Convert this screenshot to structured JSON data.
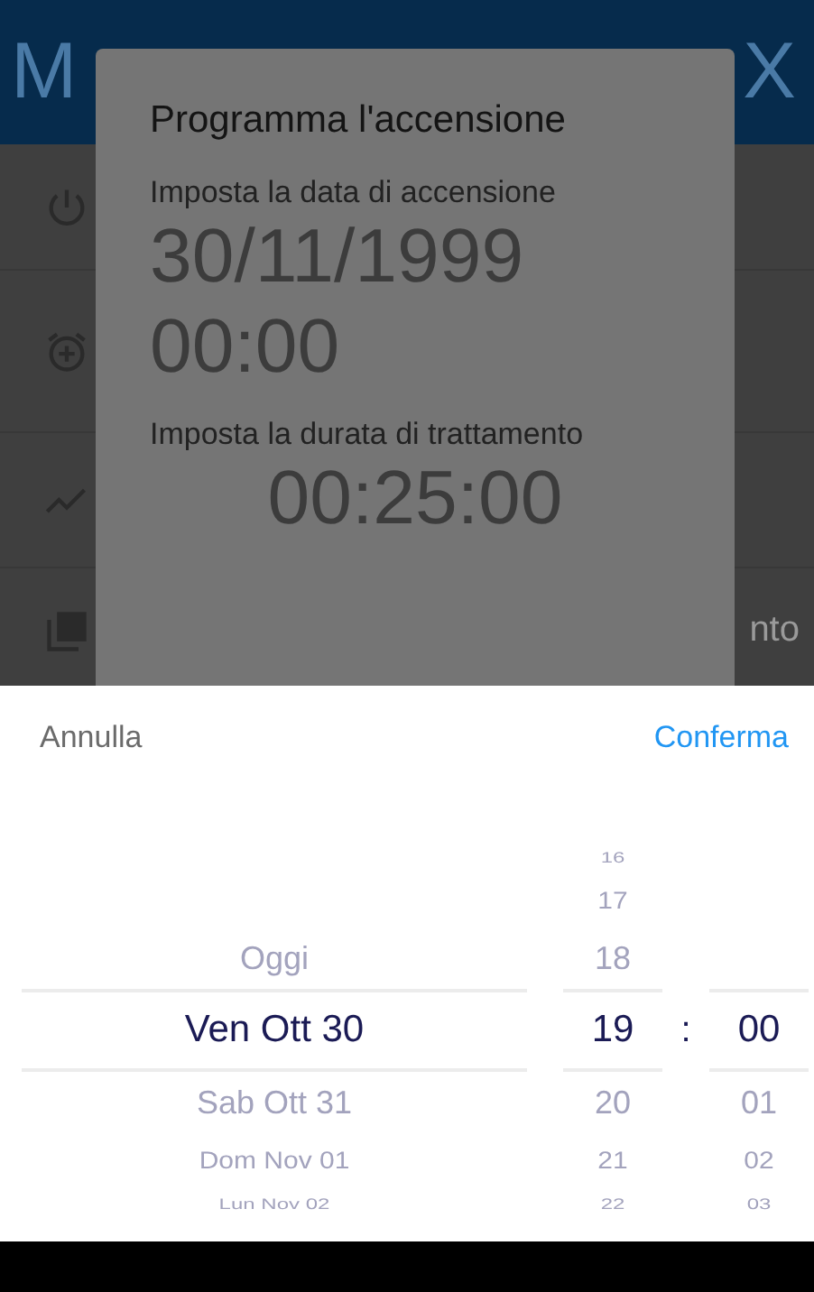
{
  "background": {
    "header": {
      "title_start": "M",
      "title_end": "X"
    },
    "menu_items": [
      {
        "kind": "power"
      },
      {
        "kind": "alarm"
      },
      {
        "kind": "trend"
      },
      {
        "kind": "pdf",
        "label": "nto"
      }
    ]
  },
  "dialog": {
    "title": "Programma l'accensione",
    "date_label": "Imposta la data di accensione",
    "date_value": "30/11/1999",
    "time_value": "00:00",
    "duration_label": "Imposta la durata di trattamento",
    "duration_value": "00:25:00"
  },
  "picker": {
    "cancel": "Annulla",
    "confirm": "Conferma",
    "separator": ":",
    "columns": [
      {
        "kind": "day",
        "items": [
          {
            "label": "Oggi",
            "selected": false
          },
          {
            "label": "Ven Ott 30",
            "selected": true
          },
          {
            "label": "Sab Ott 31",
            "selected": false
          },
          {
            "label": "Dom Nov 01",
            "selected": false
          },
          {
            "label": "Lun Nov 02",
            "selected": false
          }
        ]
      },
      {
        "kind": "hour",
        "items": [
          {
            "label": "16",
            "selected": false
          },
          {
            "label": "17",
            "selected": false
          },
          {
            "label": "18",
            "selected": false
          },
          {
            "label": "19",
            "selected": true
          },
          {
            "label": "20",
            "selected": false
          },
          {
            "label": "21",
            "selected": false
          },
          {
            "label": "22",
            "selected": false
          }
        ]
      },
      {
        "kind": "minute",
        "items": [
          {
            "label": "00",
            "selected": true
          },
          {
            "label": "01",
            "selected": false
          },
          {
            "label": "02",
            "selected": false
          },
          {
            "label": "03",
            "selected": false
          }
        ]
      }
    ]
  }
}
